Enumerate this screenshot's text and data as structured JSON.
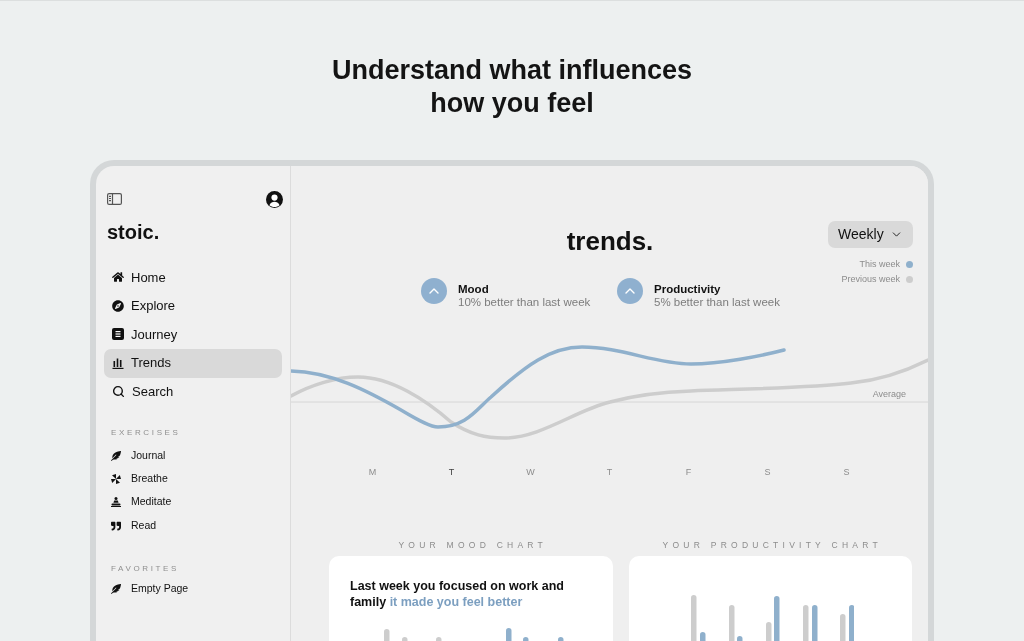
{
  "headline": "Understand what influences how you feel",
  "sidebar": {
    "logo": "stoic.",
    "nav": [
      {
        "label": "Home",
        "selected": false
      },
      {
        "label": "Explore",
        "selected": false
      },
      {
        "label": "Journey",
        "selected": false
      },
      {
        "label": "Trends",
        "selected": true
      },
      {
        "label": "Search",
        "selected": false
      }
    ],
    "sections": [
      {
        "title": "EXERCISES",
        "items": [
          {
            "label": "Journal"
          },
          {
            "label": "Breathe"
          },
          {
            "label": "Meditate"
          },
          {
            "label": "Read"
          }
        ]
      },
      {
        "title": "FAVORITES",
        "items": [
          {
            "label": "Empty Page"
          }
        ]
      }
    ]
  },
  "main": {
    "title": "trends.",
    "period": "Weekly",
    "legend": [
      {
        "label": "This week",
        "color": "#8fb0cc"
      },
      {
        "label": "Previous week",
        "color": "#cdcdcd"
      }
    ],
    "stats": [
      {
        "name": "Mood",
        "detail": "10% better than last week"
      },
      {
        "name": "Productivity",
        "detail": "5% better than last week"
      }
    ],
    "trend_chart": {
      "average_label": "Average",
      "days": [
        {
          "label": "M",
          "selected": false
        },
        {
          "label": "T",
          "selected": true
        },
        {
          "label": "W",
          "selected": false
        },
        {
          "label": "T",
          "selected": false
        },
        {
          "label": "F",
          "selected": false
        },
        {
          "label": "S",
          "selected": false
        },
        {
          "label": "S",
          "selected": false
        }
      ]
    },
    "cards": [
      {
        "title": "YOUR MOOD CHART",
        "text": "Last week you focused on work and family",
        "highlight": "it made you feel better"
      },
      {
        "title": "YOUR PRODUCTIVITY CHART"
      }
    ]
  }
}
